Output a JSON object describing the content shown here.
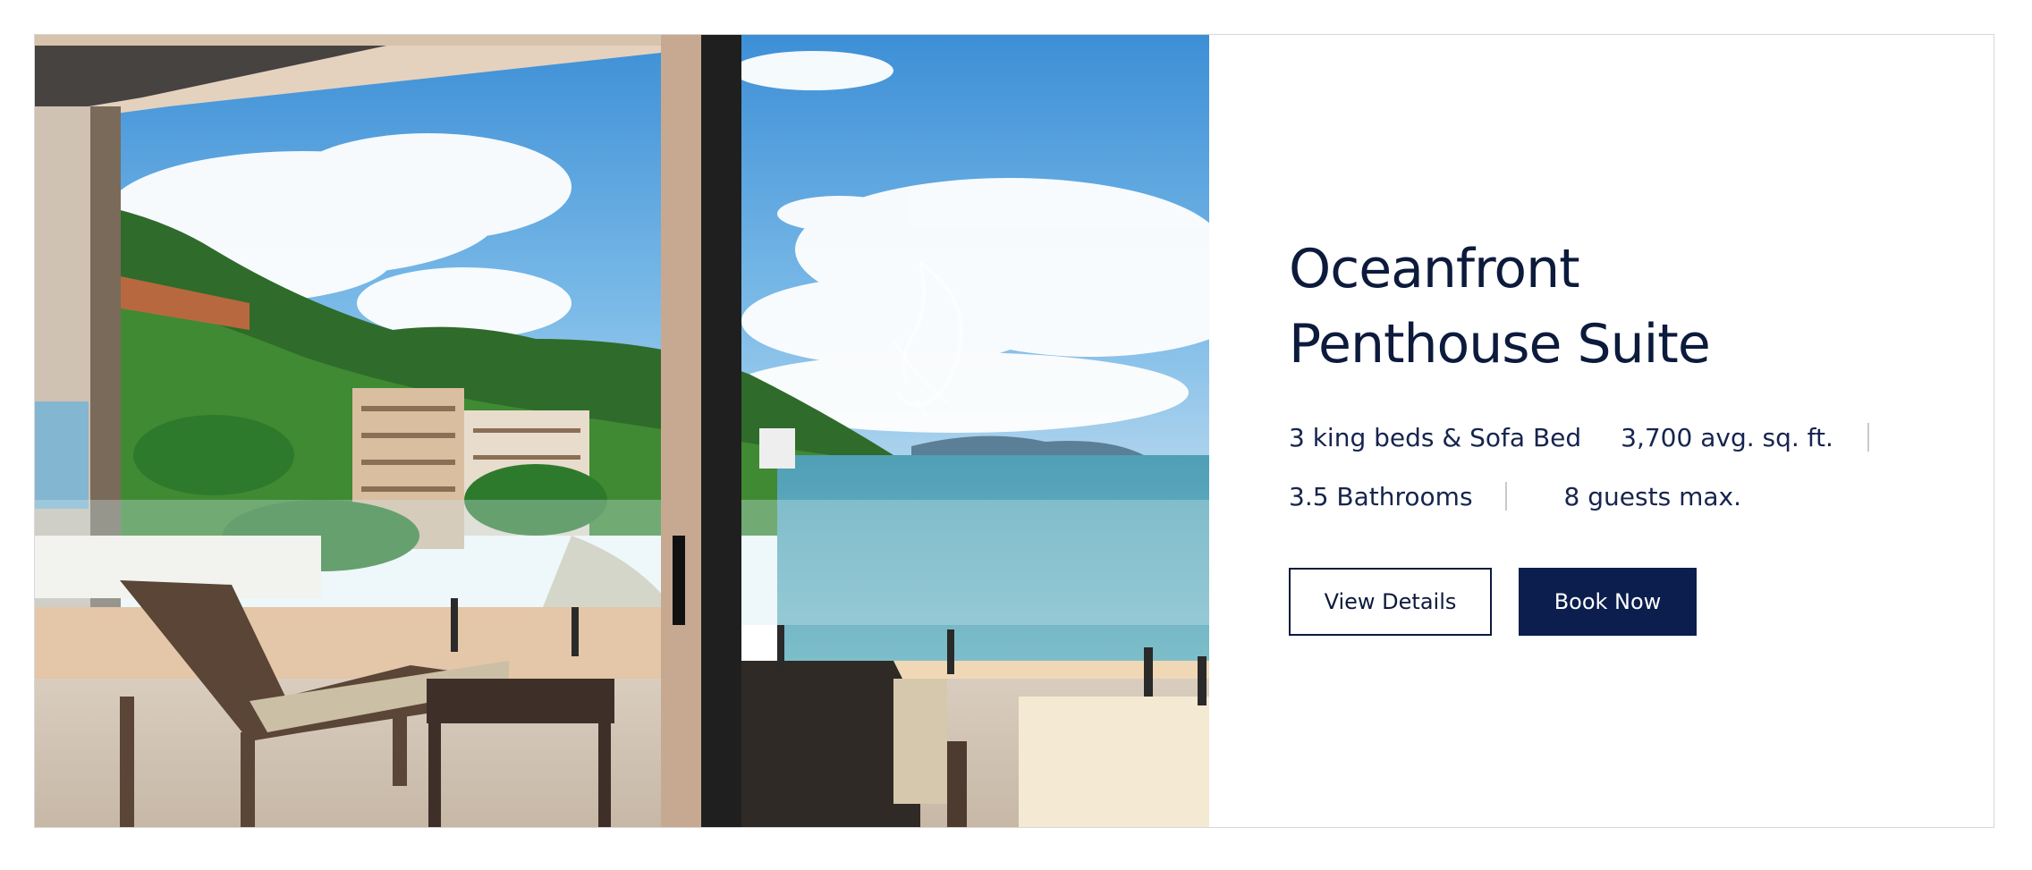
{
  "suite": {
    "title_line1": "Oceanfront",
    "title_line2": "Penthouse Suite",
    "features": {
      "beds": "3 king beds & Sofa Bed",
      "size": "3,700 avg. sq. ft.",
      "bathrooms": "3.5 Bathrooms",
      "guests": "8 guests max."
    }
  },
  "actions": {
    "view_details_label": "View Details",
    "book_now_label": "Book Now"
  },
  "image": {
    "subject": "balcony-ocean-view-photo",
    "watermark_icon": "heron-logo-icon"
  },
  "colors": {
    "navy": "#0b1e4d",
    "text": "#16244f",
    "separator": "#c7c9cf",
    "sky": "#5ba8e3",
    "ocean": "#6fb6c6"
  }
}
